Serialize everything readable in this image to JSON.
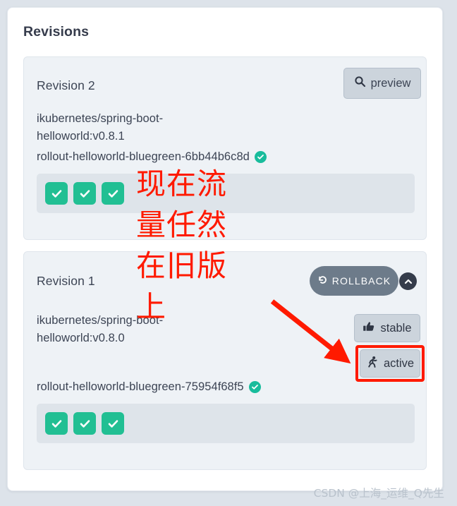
{
  "page": {
    "title": "Revisions",
    "watermark": "CSDN @上海_运维_Q先生"
  },
  "annotation": {
    "text": "现在流\n量任然\n在旧版\n上",
    "color": "#ff1a00",
    "arrow_note": "red arrow pointing at the active badge"
  },
  "colors": {
    "page_background": "#dde3ea",
    "card_background": "#ffffff",
    "panel_background": "#eef2f6",
    "pods_container": "#dee4ea",
    "pod_healthy": "#21bf93",
    "healthy_dot": "#18bc9c",
    "button_face": "#ccd4dc",
    "rollback": "#6d7b8a",
    "collapse_circle": "#353c4b",
    "annotation_red": "#ff1a00",
    "text_primary": "#3c4454"
  },
  "revisions": [
    {
      "label": "Revision 2",
      "image": "ikubernetes/spring-boot-helloworld:v0.8.1",
      "rollout_name": "rollout-helloworld-bluegreen-6bb44b6c8d",
      "rollout_status_icon": "check-circle-icon",
      "collapse_icon": "chevron-up-icon",
      "pods": [
        {
          "status": "healthy",
          "icon": "check-icon"
        },
        {
          "status": "healthy",
          "icon": "check-icon"
        },
        {
          "status": "healthy",
          "icon": "check-icon"
        }
      ],
      "actions": [
        {
          "id": "preview",
          "label": "preview",
          "icon": "search-icon"
        }
      ],
      "badges": []
    },
    {
      "label": "Revision 1",
      "image": "ikubernetes/spring-boot-helloworld:v0.8.0",
      "rollout_name": "rollout-helloworld-bluegreen-75954f68f5",
      "rollout_status_icon": "check-circle-icon",
      "collapse_icon": "chevron-up-icon",
      "pods": [
        {
          "status": "healthy",
          "icon": "check-icon"
        },
        {
          "status": "healthy",
          "icon": "check-icon"
        },
        {
          "status": "healthy",
          "icon": "check-icon"
        }
      ],
      "actions": [
        {
          "id": "rollback",
          "label": "ROLLBACK",
          "icon": "undo-icon"
        }
      ],
      "badges": [
        {
          "id": "stable",
          "label": "stable",
          "icon": "thumbs-up-icon",
          "highlighted": false
        },
        {
          "id": "active",
          "label": "active",
          "icon": "running-person-icon",
          "highlighted": true
        }
      ]
    }
  ]
}
